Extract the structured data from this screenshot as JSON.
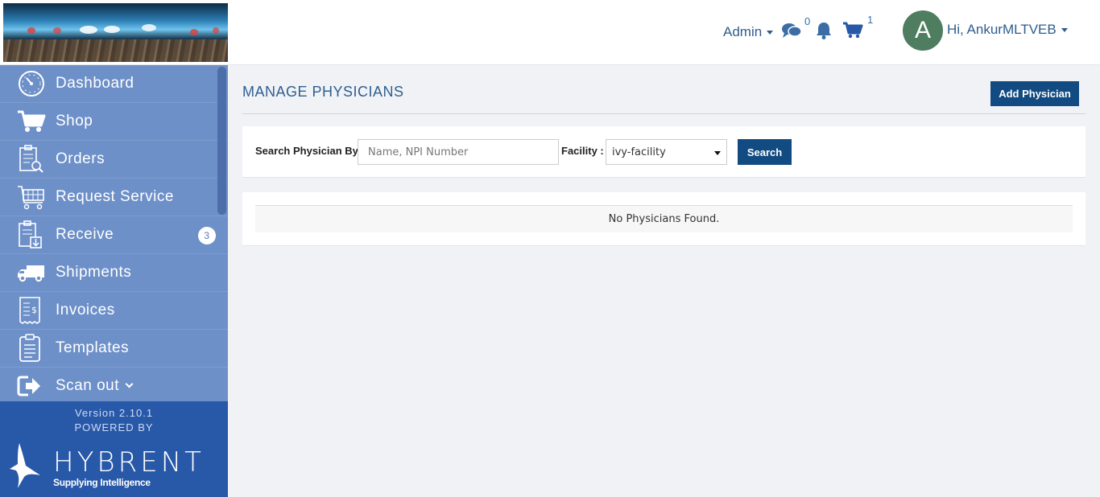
{
  "header": {
    "admin_label": "Admin",
    "messages_count": "0",
    "cart_count": "1",
    "avatar_initial": "A",
    "greeting": "Hi, AnkurMLTVEB"
  },
  "sidebar": {
    "items": [
      {
        "label": "Dashboard",
        "icon": "dashboard-gauge-icon"
      },
      {
        "label": "Shop",
        "icon": "shopping-cart-icon"
      },
      {
        "label": "Orders",
        "icon": "clipboard-search-icon"
      },
      {
        "label": "Request Service",
        "icon": "service-cart-icon"
      },
      {
        "label": "Receive",
        "icon": "receive-clipboard-icon",
        "badge": "3"
      },
      {
        "label": "Shipments",
        "icon": "delivery-truck-icon"
      },
      {
        "label": "Invoices",
        "icon": "invoice-receipt-icon"
      },
      {
        "label": "Templates",
        "icon": "template-clipboard-icon"
      },
      {
        "label": "Scan out",
        "icon": "sign-out-icon"
      }
    ],
    "version": "Version 2.10.1",
    "powered_by": "POWERED BY",
    "brand_name": "HYBRENT",
    "brand_tagline": "Supplying Intelligence"
  },
  "main": {
    "title": "MANAGE PHYSICIANS",
    "add_button": "Add Physician",
    "search_label": "Search Physician By",
    "search_placeholder": "Name, NPI Number",
    "facility_label": "Facility :",
    "facility_value": "ivy-facility",
    "search_button": "Search",
    "empty_message": "No Physicians Found."
  },
  "colors": {
    "accent": "#124b82",
    "sidebar": "#6d90c9",
    "footer": "#2858a8",
    "link": "#2f5d8e"
  }
}
